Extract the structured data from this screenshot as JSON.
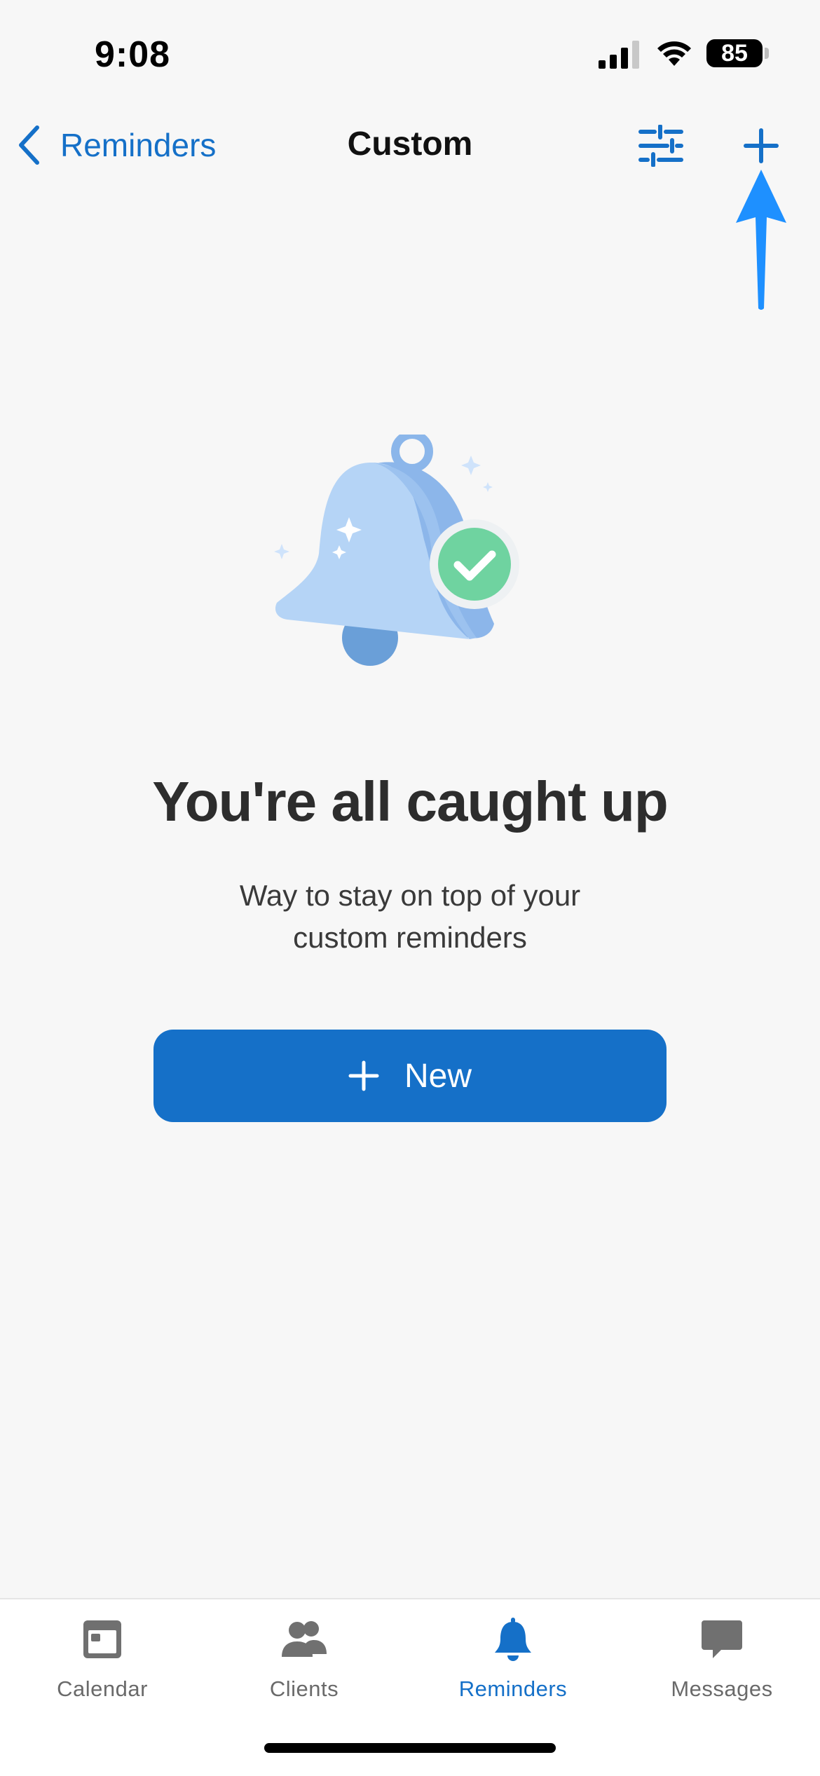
{
  "status_bar": {
    "time": "9:08",
    "battery": "85",
    "icons": [
      "signal-icon",
      "wifi-icon",
      "battery-icon"
    ]
  },
  "nav": {
    "back_label": "Reminders",
    "title": "Custom",
    "icons": [
      "chevron-left-icon",
      "filter-sliders-icon",
      "plus-icon"
    ]
  },
  "empty_state": {
    "illustration": "bell-check-illustration",
    "title": "You're all caught up",
    "subtitle_line1": "Way to stay on top of your",
    "subtitle_line2": "custom reminders"
  },
  "new_button": {
    "label": "New",
    "icon": "plus-icon"
  },
  "tabs": [
    {
      "label": "Calendar",
      "icon": "calendar-icon",
      "active": false
    },
    {
      "label": "Clients",
      "icon": "clients-icon",
      "active": false
    },
    {
      "label": "Reminders",
      "icon": "bell-icon",
      "active": true
    },
    {
      "label": "Messages",
      "icon": "message-icon",
      "active": false
    }
  ],
  "colors": {
    "accent": "#1570c8",
    "annotation_arrow": "#1e90ff",
    "background": "#f7f7f7",
    "success": "#6fd3a0"
  }
}
